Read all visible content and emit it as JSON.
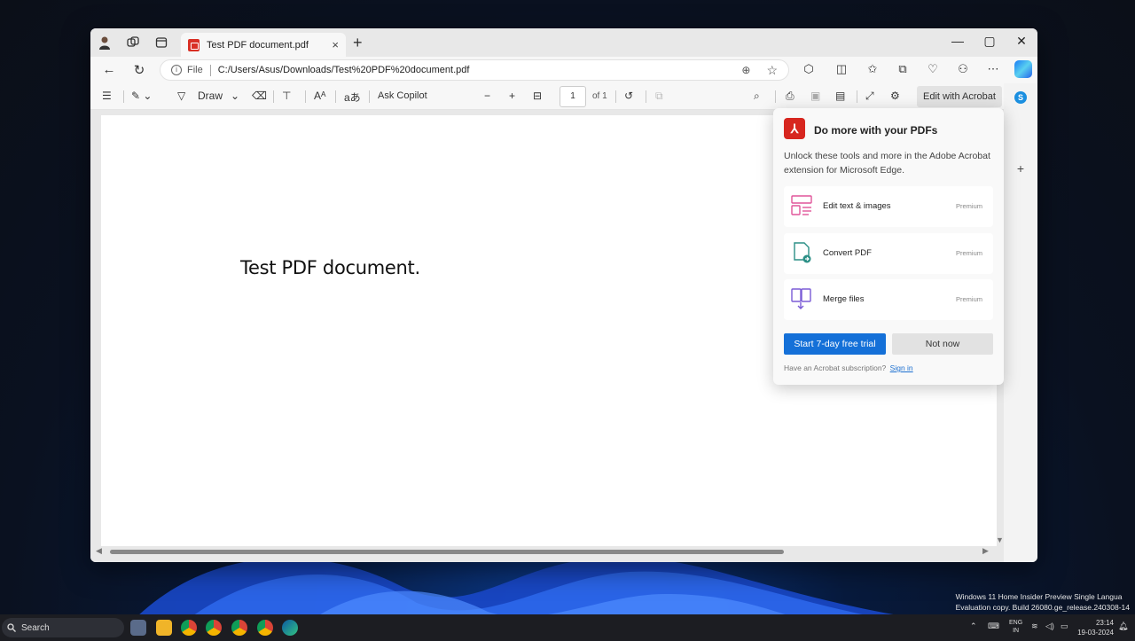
{
  "tab": {
    "title": "Test PDF document.pdf",
    "close": "×",
    "new": "+"
  },
  "window_controls": {
    "minimize": "—",
    "maximize": "▢",
    "close": "✕"
  },
  "address": {
    "scheme_label": "File",
    "url": "C:/Users/Asus/Downloads/Test%20PDF%20document.pdf"
  },
  "pdf_toolbar": {
    "draw_label": "Draw",
    "ask_copilot": "Ask Copilot",
    "zoom_out": "−",
    "zoom_in": "+",
    "page_current": "1",
    "page_total": "of 1",
    "edit_with_acrobat": "Edit with Acrobat"
  },
  "document": {
    "text": "Test PDF document."
  },
  "popup": {
    "title": "Do more with your PDFs",
    "description": "Unlock these tools and more in the Adobe Acrobat extension for Microsoft Edge.",
    "features": [
      {
        "label": "Edit text & images",
        "badge": "Premium"
      },
      {
        "label": "Convert PDF",
        "badge": "Premium"
      },
      {
        "label": "Merge files",
        "badge": "Premium"
      }
    ],
    "primary_button": "Start 7-day free trial",
    "secondary_button": "Not now",
    "subscription_text": "Have an Acrobat subscription?",
    "sign_in": "Sign in"
  },
  "taskbar": {
    "search": "Search",
    "lang_top": "ENG",
    "lang_bottom": "IN",
    "time": "23:14",
    "date": "19-03-2024"
  },
  "watermark": {
    "line1": "Windows 11 Home Insider Preview Single Langua",
    "line2": "Evaluation copy. Build 26080.ge_release.240308-14"
  },
  "colors": {
    "accent": "#1470d8",
    "acrobat_red": "#d7261f",
    "taskbar": "#1c1d22"
  }
}
